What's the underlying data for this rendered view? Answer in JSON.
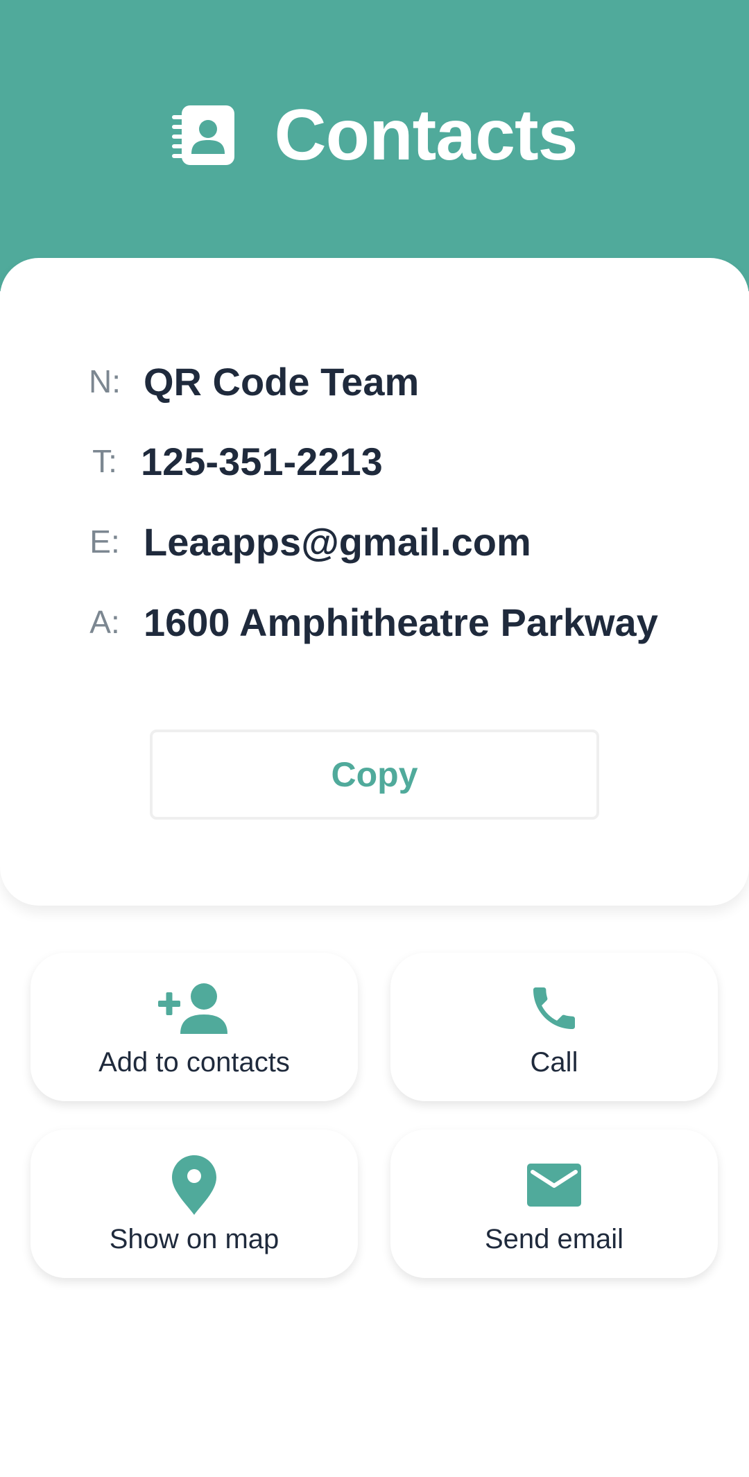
{
  "header": {
    "title": "Contacts",
    "icon": "contact-book-icon",
    "background": "#50aa9b"
  },
  "contact": {
    "fields": [
      {
        "label": "N:",
        "value": "QR Code Team"
      },
      {
        "label": "T:",
        "value": "125-351-2213"
      },
      {
        "label": "E:",
        "value": "Leaapps@gmail.com"
      },
      {
        "label": "A:",
        "value": "1600 Amphitheatre Parkway"
      }
    ],
    "copy_label": "Copy"
  },
  "actions": {
    "add_contact": {
      "label": "Add to contacts",
      "icon": "add-person-icon"
    },
    "call": {
      "label": "Call",
      "icon": "phone-icon"
    },
    "show_map": {
      "label": "Show on map",
      "icon": "map-pin-icon"
    },
    "send_email": {
      "label": "Send email",
      "icon": "envelope-icon"
    }
  },
  "colors": {
    "accent": "#50aa9b",
    "text_dark": "#1f2a3c",
    "label_gray": "#7c8791"
  }
}
